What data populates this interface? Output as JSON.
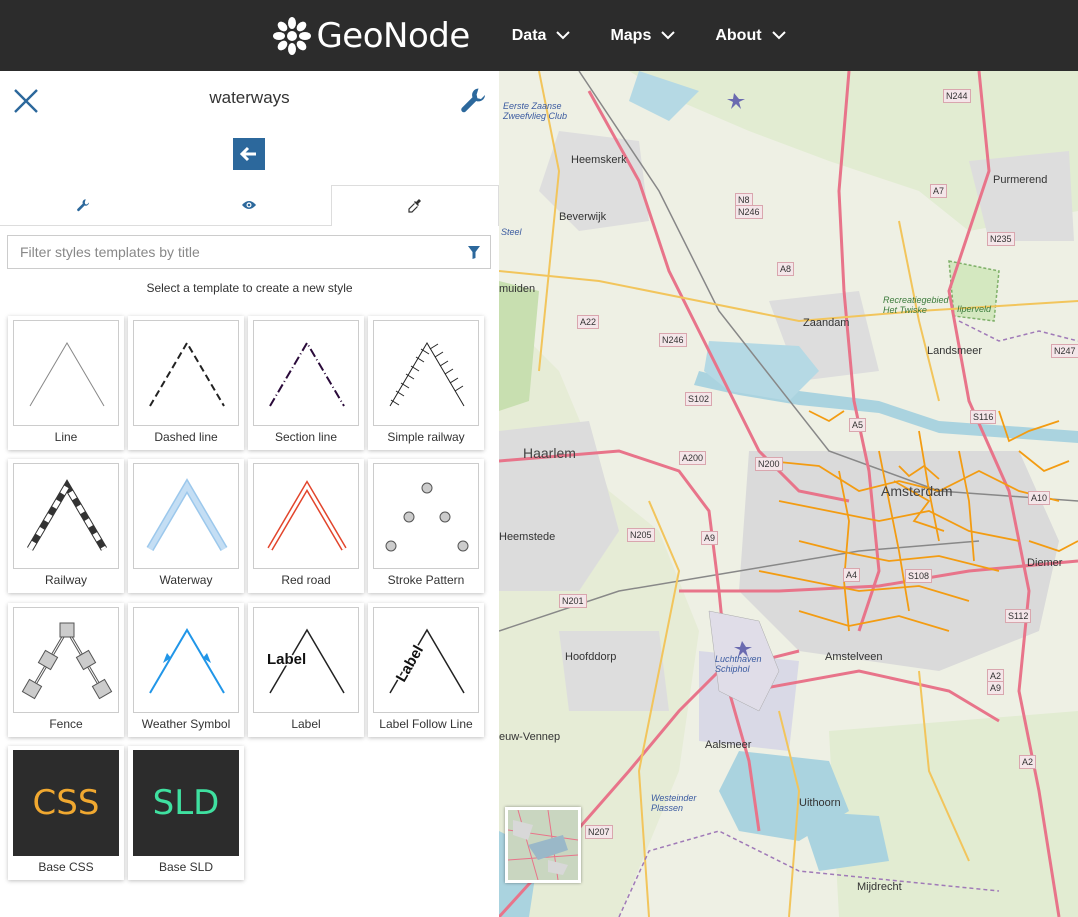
{
  "header": {
    "brand": "GeoNode",
    "nav": [
      {
        "label": "Data"
      },
      {
        "label": "Maps"
      },
      {
        "label": "About"
      }
    ]
  },
  "panel": {
    "title": "waterways",
    "filter_placeholder": "Filter styles templates by title",
    "hint": "Select a template to create a new style",
    "templates": [
      {
        "label": "Line"
      },
      {
        "label": "Dashed line"
      },
      {
        "label": "Section line"
      },
      {
        "label": "Simple railway"
      },
      {
        "label": "Railway"
      },
      {
        "label": "Waterway"
      },
      {
        "label": "Red road"
      },
      {
        "label": "Stroke Pattern"
      },
      {
        "label": "Fence"
      },
      {
        "label": "Weather Symbol"
      },
      {
        "label": "Label",
        "thumb_text": "Label"
      },
      {
        "label": "Label Follow Line",
        "thumb_text": "Label"
      },
      {
        "label": "Base CSS",
        "thumb_text": "CSS",
        "color": "#f0a830"
      },
      {
        "label": "Base SLD",
        "thumb_text": "SLD",
        "color": "#3fe0a0"
      }
    ]
  },
  "map": {
    "places": {
      "heemskerk": "Heemskerk",
      "beverwijk": "Beverwijk",
      "muiden": "muiden",
      "haarlem": "Haarlem",
      "heemstede": "Heemstede",
      "hoofddorp": "Hoofddorp",
      "nieuw_vennep": "euw-Vennep",
      "aalsmeer": "Aalsmeer",
      "amstelveen": "Amstelveen",
      "uithoorn": "Uithoorn",
      "mijdrecht": "Mijdrecht",
      "zaandam": "Zaandam",
      "landsmeer": "Landsmeer",
      "purmerend": "Purmerend",
      "amsterdam": "Amsterdam",
      "diemen": "Diemer",
      "steel": "Steel",
      "zweefvlieg": "Eerste Zaanse Zweefvlieg Club",
      "recreatie": "Recreatiegebied Het Twiske",
      "ilperveld": "Ilperveld",
      "schiphol": "Luchthaven Schiphol",
      "westeinder": "Westeinder Plassen"
    },
    "shields": {
      "n244": "N244",
      "n8": "N8",
      "n246": "N246",
      "a7": "A7",
      "n235": "N235",
      "a8": "A8",
      "a22": "A22",
      "n246b": "N246",
      "n247": "N247",
      "s102": "S102",
      "a5": "A5",
      "s116": "S116",
      "a200": "A200",
      "n200": "N200",
      "a10": "A10",
      "n205": "N205",
      "a9": "A9",
      "a4": "A4",
      "s108": "S108",
      "n201": "N201",
      "s112": "S112",
      "a2": "A2",
      "a9b": "A9",
      "a2b": "A2",
      "n207": "N207"
    }
  }
}
